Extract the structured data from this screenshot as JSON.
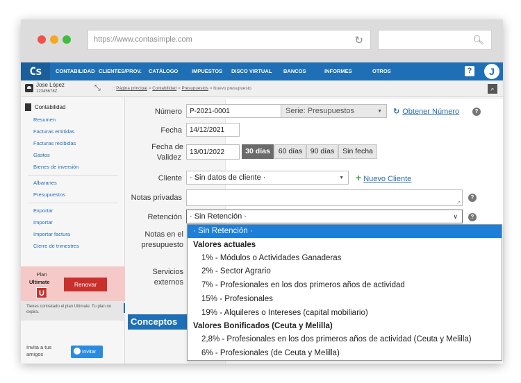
{
  "browser": {
    "url": "https://www.contasimple.com"
  },
  "nav": {
    "logo": "Cs",
    "items": [
      "CONTABILIDAD",
      "CLIENTES/PROV.",
      "CATÁLOGO",
      "IMPUESTOS",
      "DISCO VIRTUAL",
      "BANCOS",
      "INFORMES",
      "OTROS"
    ],
    "help": "?",
    "avatar_initial": "J"
  },
  "user": {
    "name": "Jose López",
    "id": "12345678Z"
  },
  "breadcrumb": {
    "prefix": "::",
    "home": "Página principal",
    "section": "Contabilidad",
    "list": "Presupuestos",
    "current": "Nuevo presupuesto",
    "sep": ">"
  },
  "sidebar": {
    "heading": "Contabilidad",
    "group1": [
      "Resumen",
      "Facturas emitidas",
      "Facturas recibidas",
      "Gastos",
      "Bienes de inversión"
    ],
    "group2": [
      "Albaranes",
      "Presupuestos"
    ],
    "group3": [
      "Exportar",
      "Importar",
      "Importar factura",
      "Cierre de trimestres"
    ]
  },
  "plan": {
    "label": "Plan",
    "name": "Ultimate",
    "badge": "U",
    "renew": "Renovar",
    "message": "Tienes contratado el plan Ultimate. Tu plan no expira."
  },
  "invite": {
    "text": "Invita a tus amigos",
    "button": "Invitar"
  },
  "form": {
    "numero_label": "Número",
    "numero_value": "P-2021-0001",
    "serie_value": "Serie: Presupuestos",
    "obtener_numero": "Obtener Número",
    "fecha_label": "Fecha",
    "fecha_value": "14/12/2021",
    "validez_label_1": "Fecha de",
    "validez_label_2": "Validez",
    "validez_value": "13/01/2022",
    "validez_options": [
      "30 días",
      "60 días",
      "90 días",
      "Sin fecha"
    ],
    "cliente_label": "Cliente",
    "cliente_value": "· Sin datos de cliente ·",
    "nuevo_cliente": "Nuevo Cliente",
    "notas_privadas_label": "Notas privadas",
    "retencion_label": "Retención",
    "retencion_value": "· Sin Retención ·",
    "notas_presupuesto_1": "Notas en el",
    "notas_presupuesto_2": "presupuesto",
    "servicios_1": "Servicios",
    "servicios_2": "externos",
    "conceptos": "Conceptos"
  },
  "retencion_dropdown": {
    "selected": "· Sin Retención ·",
    "group_actual": "Valores actuales",
    "actual": [
      "1% - Módulos o Actividades Ganaderas",
      "2% - Sector Agrario",
      "7% - Profesionales en los dos primeros años de actividad",
      "15% - Profesionales",
      "19% - Alquileres o Intereses (capital mobiliario)"
    ],
    "group_bonificados": "Valores Bonificados (Ceuta y Melilla)",
    "bonificados": [
      "2,8% - Profesionales en los dos primeros años de actividad (Ceuta y Melilla)",
      "6% - Profesionales (de Ceuta y Melilla)"
    ]
  },
  "colors": {
    "brand_blue": "#1e6fb5",
    "selected_blue": "#1e7fd8",
    "renew_red": "#c9302c",
    "plan_bg": "#f4c9c7",
    "add_green": "#3aa23a"
  }
}
